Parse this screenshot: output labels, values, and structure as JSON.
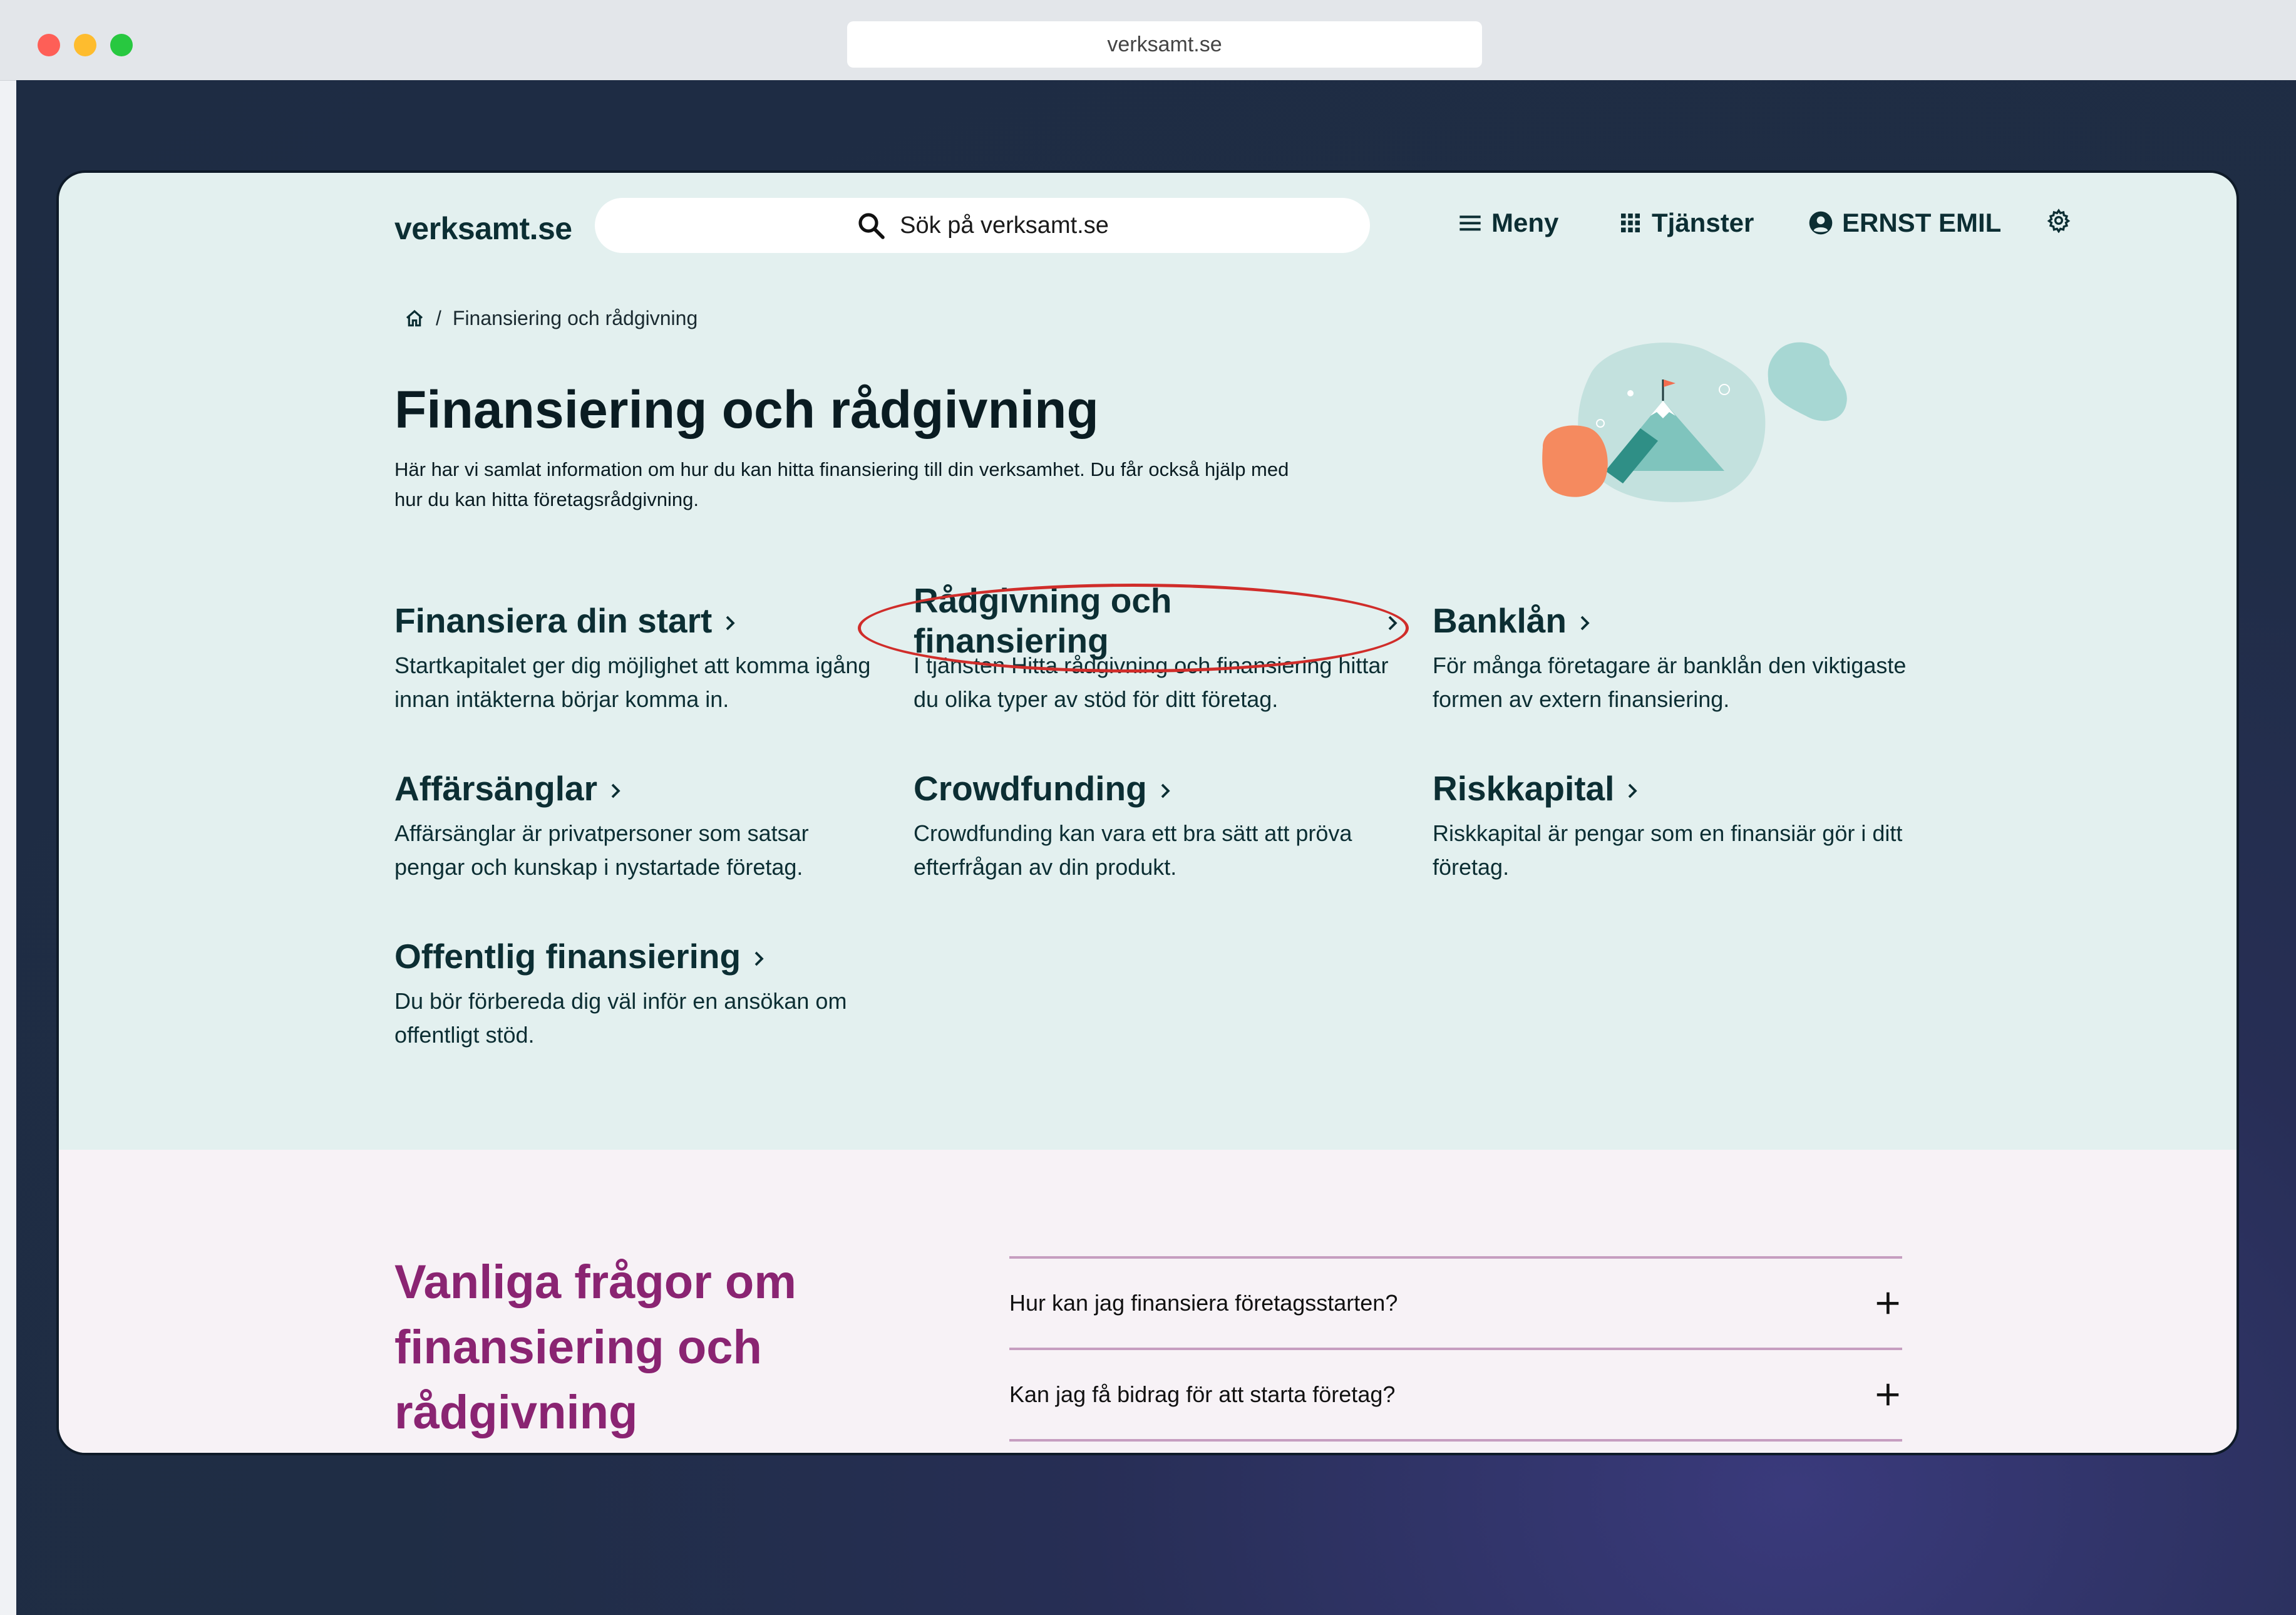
{
  "browser": {
    "url": "verksamt.se"
  },
  "header": {
    "logo": "verksamt.se",
    "search_placeholder": "Sök på verksamt.se",
    "menu_label": "Meny",
    "services_label": "Tjänster",
    "user_label": "ERNST EMIL"
  },
  "breadcrumb": {
    "separator": "/",
    "current": "Finansiering och rådgivning"
  },
  "page": {
    "title": "Finansiering och rådgivning",
    "intro": "Här har vi samlat information om hur du kan hitta finansiering till din verksamhet. Du får också hjälp med hur du kan hitta företagsrådgivning."
  },
  "links": [
    {
      "title": "Finansiera din start",
      "desc": "Startkapitalet ger dig möjlighet att komma igång innan intäkterna börjar komma in."
    },
    {
      "title": "Rådgivning och finansiering",
      "desc": "I tjänsten Hitta rådgivning och finansiering hittar du olika typer av stöd för ditt företag."
    },
    {
      "title": "Banklån",
      "desc": "För många företagare är banklån den viktigaste formen av extern finansiering."
    },
    {
      "title": "Affärsänglar",
      "desc": "Affärsänglar är privatpersoner som satsar pengar och kunskap i nystartade företag."
    },
    {
      "title": "Crowdfunding",
      "desc": "Crowdfunding kan vara ett bra sätt att pröva efterfrågan av din produkt."
    },
    {
      "title": "Riskkapital",
      "desc": "Riskkapital är pengar som en finansiär gör i ditt företag."
    },
    {
      "title": "Offentlig finansiering",
      "desc": "Du bör förbereda dig väl inför en ansökan om offentligt stöd."
    }
  ],
  "faq": {
    "heading": "Vanliga frågor om finansiering och rådgivning",
    "items": [
      "Hur kan jag finansiera företagsstarten?",
      "Kan jag få bidrag för att starta företag?"
    ]
  },
  "colors": {
    "page_bg": "#e3f0ef",
    "primary_text": "#0c2e33",
    "faq_accent": "#8a2472",
    "highlight": "#d02d2a"
  }
}
